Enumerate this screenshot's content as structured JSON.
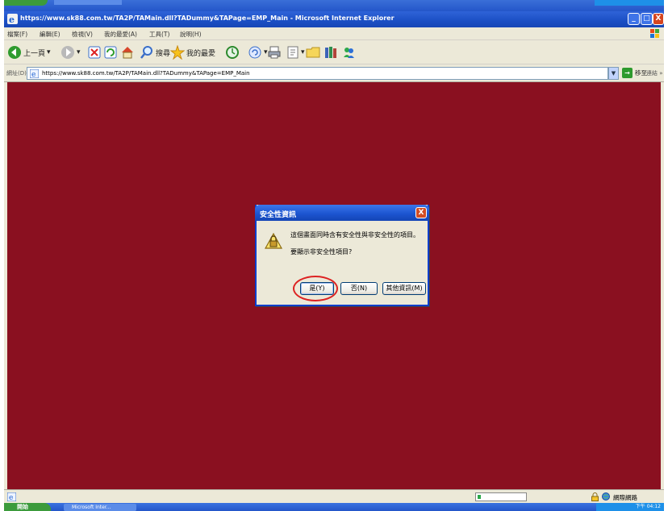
{
  "window": {
    "title": "https://www.sk88.com.tw/TA2P/TAMain.dll?TADummy&TAPage=EMP_Main - Microsoft Internet Explorer",
    "min_label": "_",
    "max_label": "□",
    "close_label": "X"
  },
  "menu": {
    "items": [
      "檔案(F)",
      "編輯(E)",
      "檢視(V)",
      "我的最愛(A)",
      "工具(T)",
      "說明(H)"
    ]
  },
  "toolbar": {
    "back_label": "上一頁",
    "search_label": "搜尋",
    "favorites_label": "我的最愛"
  },
  "address": {
    "label": "網址(D)",
    "url": "https://www.sk88.com.tw/TA2P/TAMain.dll?TADummy&TAPage=EMP_Main",
    "go_label": "移至",
    "links_label": "連結 »"
  },
  "dialog": {
    "title": "安全性資訊",
    "message_line1": "這個畫面同時含有安全性與非安全性的項目。",
    "message_line2": "要顯示非安全性項目?",
    "yes_label": "是(Y)",
    "no_label": "否(N)",
    "more_info_label": "其他資訊(M)",
    "close_label": "X"
  },
  "status": {
    "zone_label": "網際網路"
  },
  "taskbar": {
    "start_label": "開始",
    "task_label": "Microsoft Inter...",
    "tray_label": "下午 04:12"
  },
  "colors": {
    "page_background": "#8a1020",
    "highlight_ring": "#dd2222",
    "xp_titlebar": "#1d55d1"
  },
  "icons": {
    "dialog": "warning-lock-icon",
    "page": "ie-page-icon"
  }
}
